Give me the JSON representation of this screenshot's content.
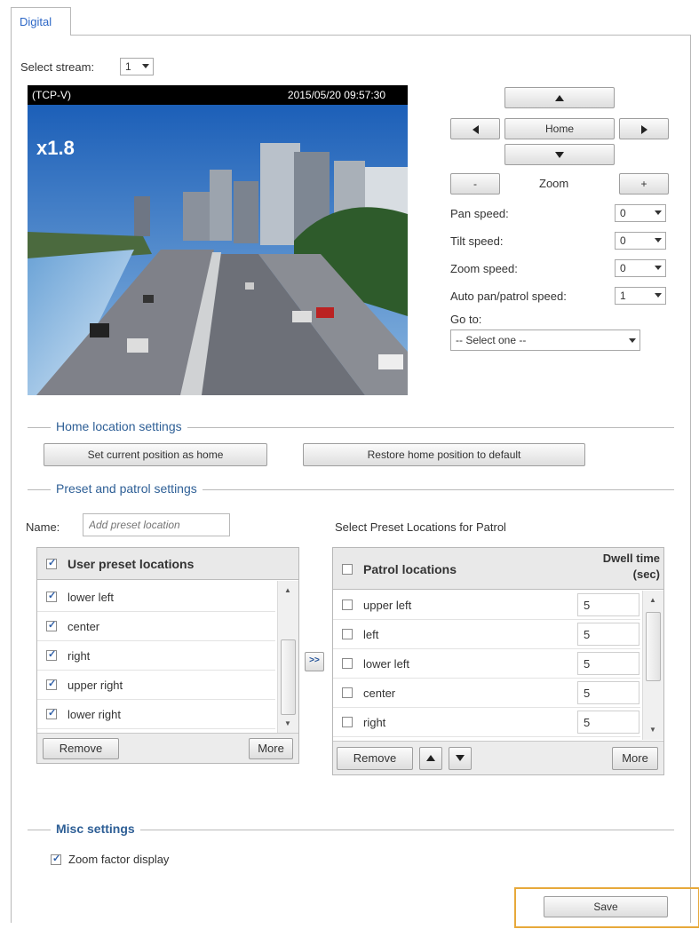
{
  "tab": {
    "label": "Digital"
  },
  "stream": {
    "label": "Select stream:",
    "value": "1"
  },
  "video": {
    "protocol": "(TCP-V)",
    "timestamp": "2015/05/20 09:57:30",
    "zoom_factor": "x1.8"
  },
  "ptz": {
    "home_label": "Home",
    "zoom_label": "Zoom",
    "zoom_out": "-",
    "zoom_in": "+",
    "speeds": [
      {
        "label": "Pan speed:",
        "value": "0"
      },
      {
        "label": "Tilt speed:",
        "value": "0"
      },
      {
        "label": "Zoom speed:",
        "value": "0"
      },
      {
        "label": "Auto pan/patrol speed:",
        "value": "1"
      }
    ],
    "goto_label": "Go to:",
    "goto_value": "-- Select one --"
  },
  "home_settings": {
    "title": "Home location settings",
    "set_label": "Set current position as home",
    "restore_label": "Restore home position to default"
  },
  "preset": {
    "title": "Preset and patrol settings",
    "name_label": "Name:",
    "name_placeholder": "Add preset location",
    "patrol_heading": "Select Preset Locations for Patrol",
    "user_header": "User preset locations",
    "user_items": [
      "lower left",
      "center",
      "right",
      "upper right",
      "lower right"
    ],
    "transfer_label": ">>",
    "remove_label": "Remove",
    "more_label": "More",
    "patrol_header": "Patrol locations",
    "dwell_header_1": "Dwell time",
    "dwell_header_2": "(sec)",
    "patrol_items": [
      {
        "name": "upper left",
        "dwell": "5"
      },
      {
        "name": "left",
        "dwell": "5"
      },
      {
        "name": "lower left",
        "dwell": "5"
      },
      {
        "name": "center",
        "dwell": "5"
      },
      {
        "name": "right",
        "dwell": "5"
      }
    ]
  },
  "misc": {
    "title": "Misc settings",
    "zoom_display_label": "Zoom factor display"
  },
  "save_label": "Save",
  "colors": {
    "section_title": "#2e5f96",
    "tab_text": "#2b66c6",
    "highlight": "#e7a93b"
  }
}
